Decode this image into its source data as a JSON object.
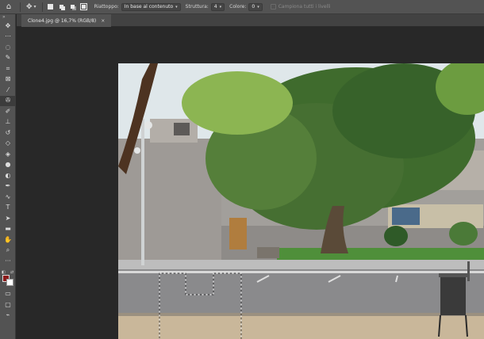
{
  "options_bar": {
    "home_icon": "home-icon",
    "tool_icon": "content-aware-move-icon",
    "riattoppo_label": "Riattoppo:",
    "riattoppo_value": "In base al contenuto",
    "struttura_label": "Struttura:",
    "struttura_value": "4",
    "colore_label": "Colore:",
    "colore_value": "0",
    "sample_all_label": "Campiona tutti i livelli"
  },
  "document": {
    "tab_title": "Clone4.jpg @ 16,7% (RGB/8)",
    "close_glyph": "×"
  },
  "colors": {
    "foreground": "#8c1b1b",
    "background": "#ffffff",
    "panel": "#535353",
    "workspace": "#282828"
  },
  "tools": [
    {
      "name": "move-tool",
      "glyph": "✥"
    },
    {
      "name": "artboard-tool",
      "glyph": "⋯"
    },
    {
      "name": "lasso-tool",
      "glyph": "◌"
    },
    {
      "name": "quick-selection-tool",
      "glyph": "✎"
    },
    {
      "name": "crop-tool",
      "glyph": "⌗"
    },
    {
      "name": "frame-tool",
      "glyph": "⊠"
    },
    {
      "name": "eyedropper-tool",
      "glyph": "⁄"
    },
    {
      "name": "spot-healing-tool",
      "glyph": "✇"
    },
    {
      "name": "brush-tool",
      "glyph": "✐"
    },
    {
      "name": "clone-stamp-tool",
      "glyph": "⊥"
    },
    {
      "name": "history-brush-tool",
      "glyph": "↺"
    },
    {
      "name": "eraser-tool",
      "glyph": "◇"
    },
    {
      "name": "paint-bucket-tool",
      "glyph": "◈"
    },
    {
      "name": "blur-tool",
      "glyph": "●"
    },
    {
      "name": "dodge-tool",
      "glyph": "◐"
    },
    {
      "name": "pen-tool",
      "glyph": "✒"
    },
    {
      "name": "freeform-pen-tool",
      "glyph": "∿"
    },
    {
      "name": "type-tool",
      "glyph": "T"
    },
    {
      "name": "path-selection-tool",
      "glyph": "➤"
    },
    {
      "name": "rectangle-tool",
      "glyph": "▬"
    },
    {
      "name": "hand-tool",
      "glyph": "✋"
    },
    {
      "name": "zoom-tool",
      "glyph": "⌕"
    },
    {
      "name": "more-tools",
      "glyph": "···"
    }
  ],
  "bottom_tools": [
    {
      "name": "quick-mask-tool",
      "glyph": "▭"
    },
    {
      "name": "screen-mode-tool",
      "glyph": "▢"
    },
    {
      "name": "edit-toolbar-tool",
      "glyph": "⌁"
    }
  ]
}
